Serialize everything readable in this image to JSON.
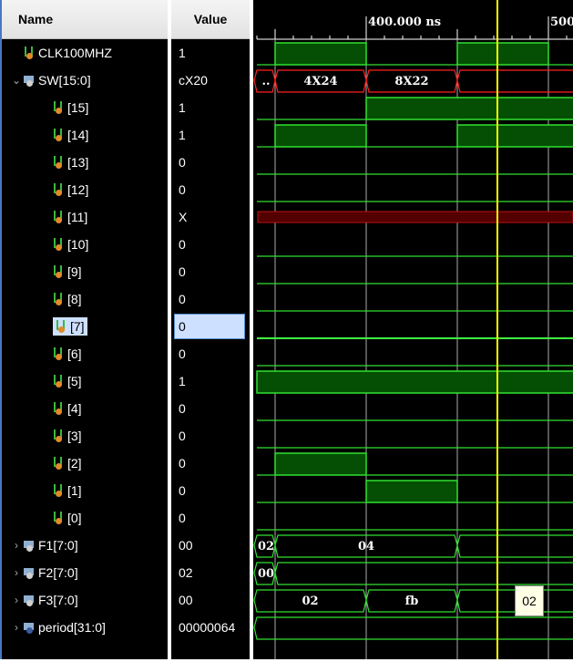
{
  "headers": {
    "name": "Name",
    "value": "Value"
  },
  "signals": [
    {
      "name": "CLK100MHZ",
      "value": "1",
      "kind": "bit",
      "indent": 1
    },
    {
      "name": "SW[15:0]",
      "value": "cX20",
      "kind": "bus",
      "indent": 0,
      "expanded": true
    },
    {
      "name": "[15]",
      "value": "1",
      "kind": "bit",
      "indent": 2
    },
    {
      "name": "[14]",
      "value": "1",
      "kind": "bit",
      "indent": 2
    },
    {
      "name": "[13]",
      "value": "0",
      "kind": "bit",
      "indent": 2
    },
    {
      "name": "[12]",
      "value": "0",
      "kind": "bit",
      "indent": 2
    },
    {
      "name": "[11]",
      "value": "X",
      "kind": "bit",
      "indent": 2
    },
    {
      "name": "[10]",
      "value": "0",
      "kind": "bit",
      "indent": 2
    },
    {
      "name": "[9]",
      "value": "0",
      "kind": "bit",
      "indent": 2
    },
    {
      "name": "[8]",
      "value": "0",
      "kind": "bit",
      "indent": 2
    },
    {
      "name": "[7]",
      "value": "0",
      "kind": "bit",
      "indent": 2,
      "selected": true
    },
    {
      "name": "[6]",
      "value": "0",
      "kind": "bit",
      "indent": 2
    },
    {
      "name": "[5]",
      "value": "1",
      "kind": "bit",
      "indent": 2
    },
    {
      "name": "[4]",
      "value": "0",
      "kind": "bit",
      "indent": 2
    },
    {
      "name": "[3]",
      "value": "0",
      "kind": "bit",
      "indent": 2
    },
    {
      "name": "[2]",
      "value": "0",
      "kind": "bit",
      "indent": 2
    },
    {
      "name": "[1]",
      "value": "0",
      "kind": "bit",
      "indent": 2
    },
    {
      "name": "[0]",
      "value": "0",
      "kind": "bit",
      "indent": 2
    },
    {
      "name": "F1[7:0]",
      "value": "00",
      "kind": "bus",
      "indent": 0
    },
    {
      "name": "F2[7:0]",
      "value": "02",
      "kind": "bus",
      "indent": 0
    },
    {
      "name": "F3[7:0]",
      "value": "00",
      "kind": "bus",
      "indent": 0
    },
    {
      "name": "period[31:0]",
      "value": "00000064",
      "kind": "per",
      "indent": 0
    }
  ],
  "timeline": {
    "labels": [
      {
        "t": 400,
        "text": "400.000 ns"
      },
      {
        "t": 500,
        "text": "500"
      }
    ],
    "cursor_ns": 472,
    "major_ns": [
      350,
      400,
      450,
      500
    ]
  },
  "waves": [
    {
      "type": "bit",
      "segs": [
        [
          0,
          350,
          0
        ],
        [
          350,
          400,
          1
        ],
        [
          400,
          450,
          0
        ],
        [
          450,
          500,
          1
        ],
        [
          500,
          999,
          0
        ]
      ]
    },
    {
      "type": "bus",
      "color": "#ff2020",
      "segs": [
        [
          0,
          350,
          ".."
        ],
        [
          350,
          400,
          "4X24"
        ],
        [
          400,
          450,
          "8X22"
        ],
        [
          450,
          999,
          ""
        ]
      ]
    },
    {
      "type": "bit",
      "segs": [
        [
          0,
          400,
          0
        ],
        [
          400,
          999,
          1
        ]
      ]
    },
    {
      "type": "bit",
      "segs": [
        [
          0,
          350,
          0
        ],
        [
          350,
          400,
          1
        ],
        [
          400,
          450,
          0
        ],
        [
          450,
          999,
          1
        ]
      ]
    },
    {
      "type": "bit",
      "segs": [
        [
          0,
          999,
          0
        ]
      ]
    },
    {
      "type": "bit",
      "segs": [
        [
          0,
          999,
          0
        ]
      ]
    },
    {
      "type": "x"
    },
    {
      "type": "bit",
      "segs": [
        [
          0,
          999,
          0
        ]
      ]
    },
    {
      "type": "bit",
      "segs": [
        [
          0,
          999,
          0
        ]
      ]
    },
    {
      "type": "bit",
      "segs": [
        [
          0,
          999,
          0
        ]
      ]
    },
    {
      "type": "bit",
      "segs": [
        [
          0,
          999,
          0
        ]
      ],
      "selected": true
    },
    {
      "type": "bit",
      "segs": [
        [
          0,
          999,
          0
        ]
      ]
    },
    {
      "type": "bit",
      "segs": [
        [
          0,
          999,
          1
        ]
      ]
    },
    {
      "type": "bit",
      "segs": [
        [
          0,
          999,
          0
        ]
      ]
    },
    {
      "type": "bit",
      "segs": [
        [
          0,
          999,
          0
        ]
      ]
    },
    {
      "type": "bit",
      "segs": [
        [
          0,
          350,
          0
        ],
        [
          350,
          400,
          1
        ],
        [
          400,
          999,
          0
        ]
      ]
    },
    {
      "type": "bit",
      "segs": [
        [
          0,
          400,
          0
        ],
        [
          400,
          450,
          1
        ],
        [
          450,
          999,
          0
        ]
      ]
    },
    {
      "type": "bit",
      "segs": [
        [
          0,
          999,
          0
        ]
      ]
    },
    {
      "type": "bus",
      "color": "#30e030",
      "segs": [
        [
          0,
          350,
          "02"
        ],
        [
          350,
          450,
          "04"
        ],
        [
          450,
          999,
          ""
        ]
      ]
    },
    {
      "type": "bus",
      "color": "#30e030",
      "segs": [
        [
          0,
          350,
          "00"
        ],
        [
          350,
          999,
          ""
        ]
      ]
    },
    {
      "type": "bus",
      "color": "#30e030",
      "segs": [
        [
          0,
          400,
          "02"
        ],
        [
          400,
          450,
          "fb"
        ],
        [
          450,
          999,
          ""
        ]
      ]
    },
    {
      "type": "bus",
      "color": "#30e030",
      "segs": [
        [
          0,
          999,
          ""
        ]
      ]
    }
  ],
  "tooltip": {
    "text": "02"
  },
  "colors": {
    "high_fill": "#044f04",
    "wave": "#30e030",
    "cursor": "#ffff00",
    "x_fill": "#520000"
  }
}
